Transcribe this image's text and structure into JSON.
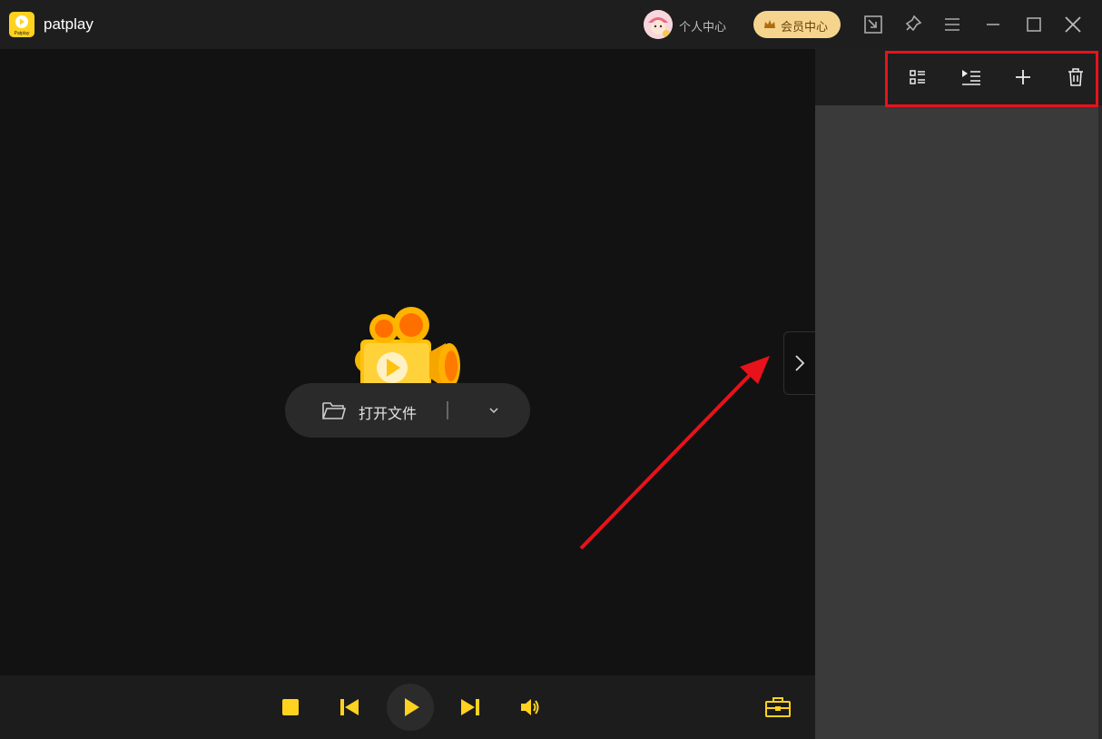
{
  "app": {
    "title": "patplay",
    "logo_text": "Patplay"
  },
  "header": {
    "user_center_label": "个人中心",
    "vip_label": "会员中心"
  },
  "main": {
    "open_file_label": "打开文件"
  },
  "colors": {
    "accent": "#FFD21F",
    "annotation_red": "#E8121B",
    "vip_bg": "#F5D58E"
  },
  "icons": {
    "titlebar": [
      "mini-mode-icon",
      "pin-icon",
      "menu-icon",
      "minimize-icon",
      "maximize-icon",
      "close-icon"
    ],
    "sidebar": [
      "playlist-view-icon",
      "play-list-icon",
      "add-icon",
      "delete-icon"
    ],
    "controls": [
      "stop-icon",
      "previous-icon",
      "play-icon",
      "next-icon",
      "volume-icon",
      "toolbox-icon"
    ]
  }
}
